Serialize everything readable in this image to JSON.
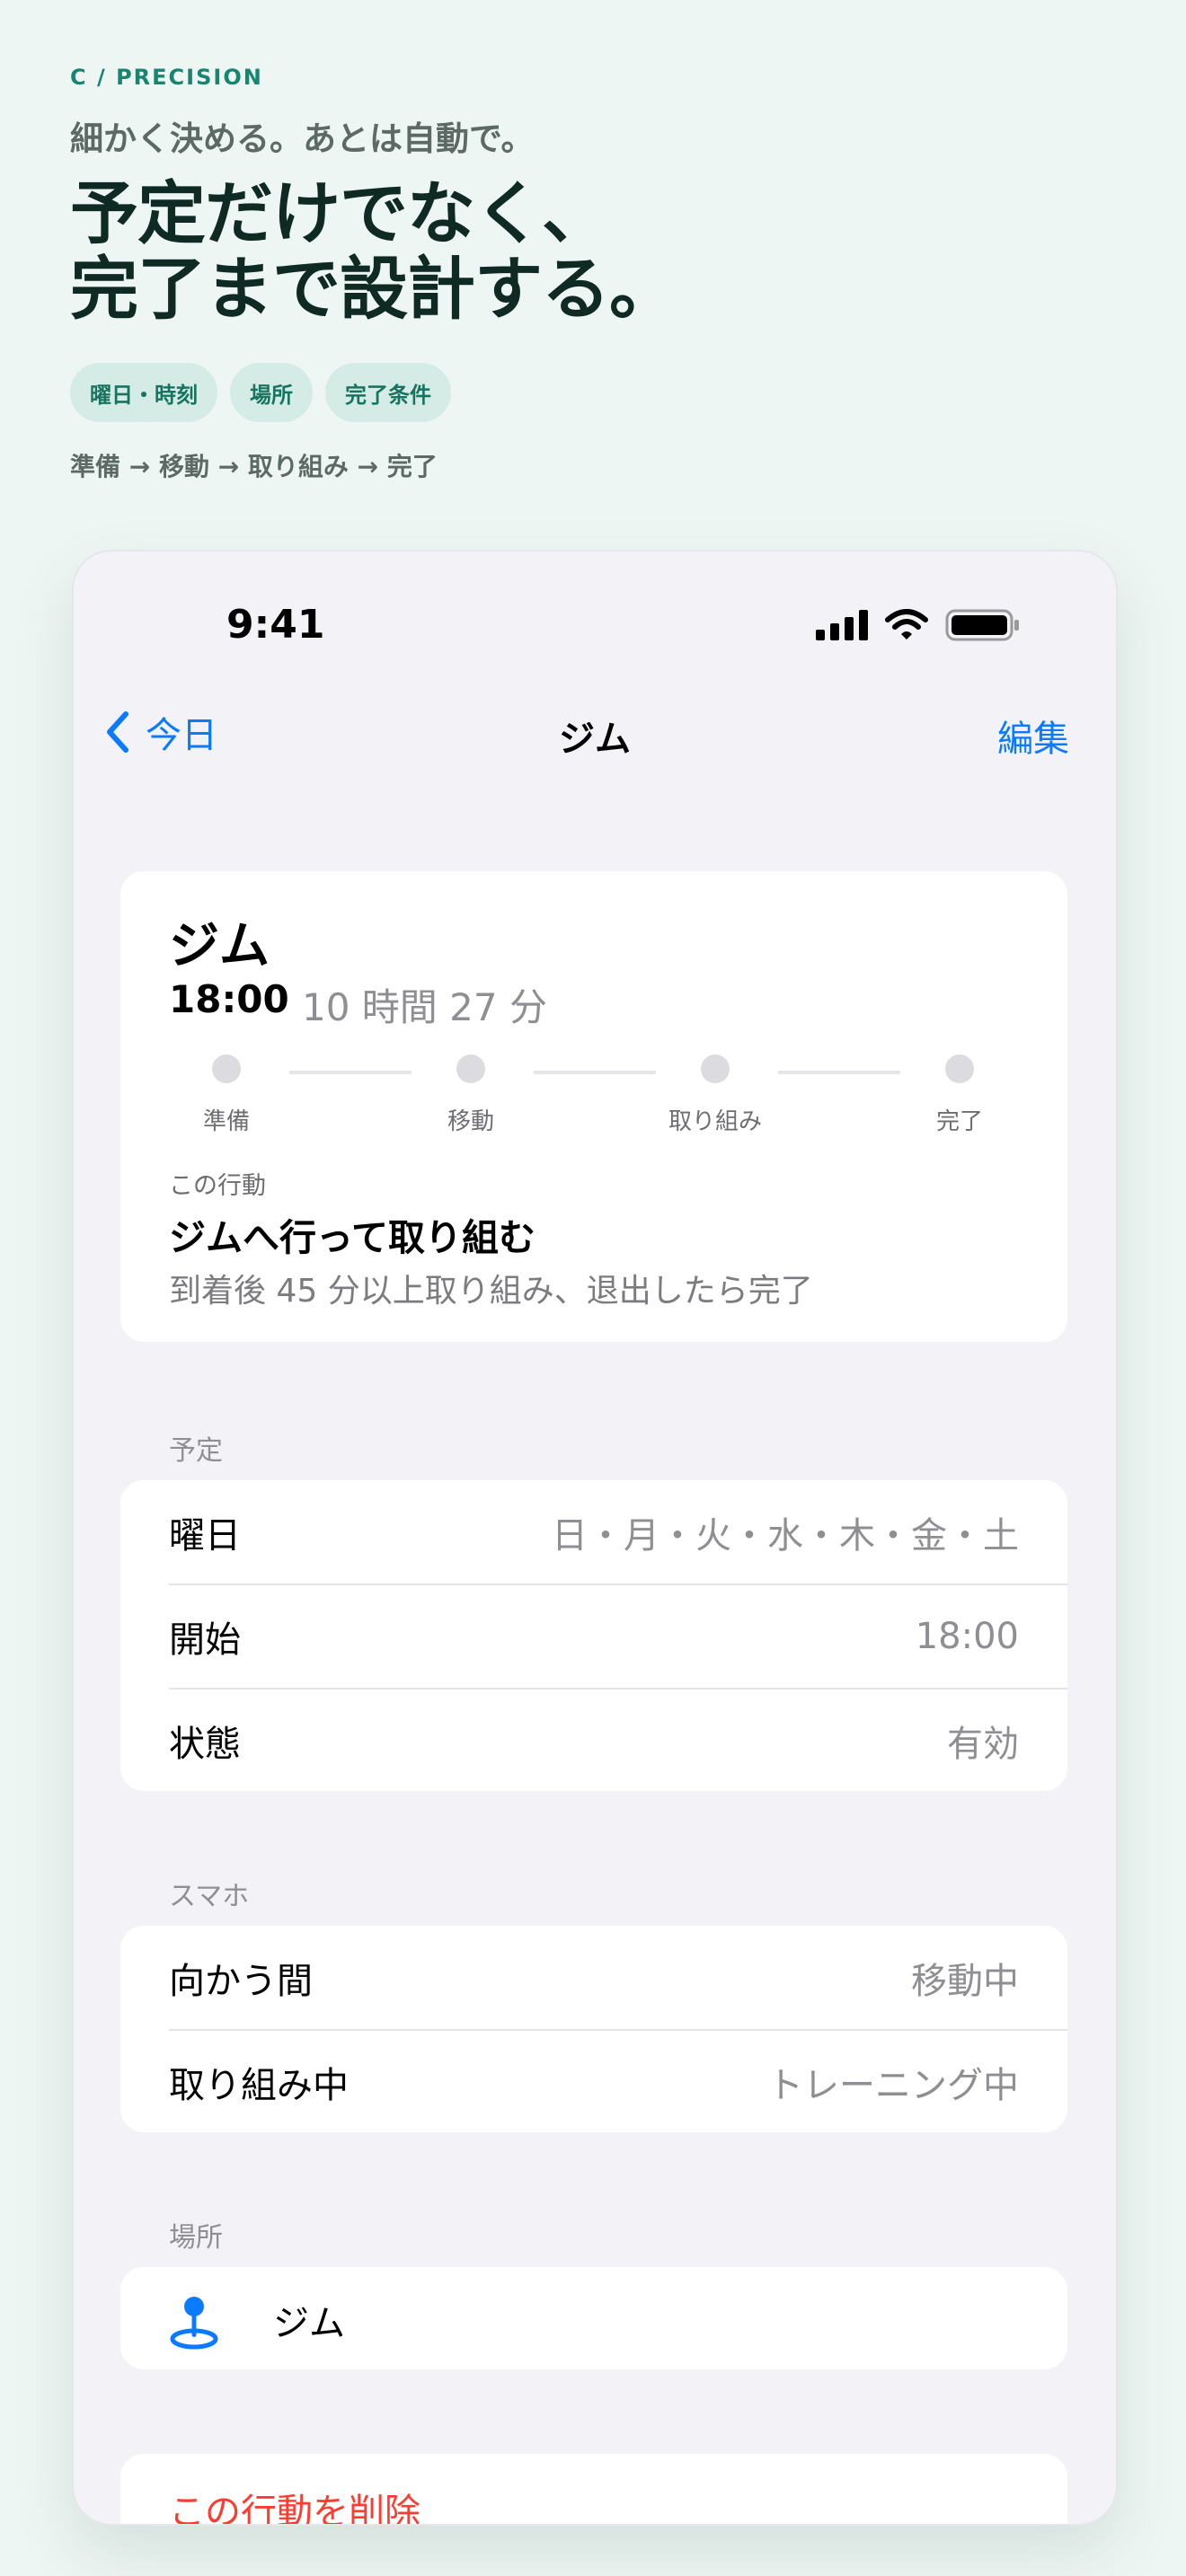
{
  "marketing": {
    "eyebrow": "C / PRECISION",
    "tagline": "細かく決める。あとは自動で。",
    "headline_line1": "予定だけでなく、",
    "headline_line2": "完了まで設計する。",
    "chips": [
      "曜日・時刻",
      "場所",
      "完了条件"
    ],
    "flow": "準備 → 移動 → 取り組み → 完了"
  },
  "status_bar": {
    "time": "9:41",
    "icons": [
      "cellular-signal-icon",
      "wifi-icon",
      "battery-icon"
    ]
  },
  "nav": {
    "back_label": "今日",
    "title": "ジム",
    "edit_label": "編集"
  },
  "summary": {
    "title": "ジム",
    "time": "18:00",
    "remaining": "10 時間 27 分",
    "steps": [
      "準備",
      "移動",
      "取り組み",
      "完了"
    ],
    "behavior_caption": "この行動",
    "behavior_title": "ジムへ行って取り組む",
    "behavior_desc": "到着後 45 分以上取り組み、退出したら完了"
  },
  "schedule": {
    "header": "予定",
    "rows": [
      {
        "label": "曜日",
        "value": "日・月・火・水・木・金・土"
      },
      {
        "label": "開始",
        "value": "18:00"
      },
      {
        "label": "状態",
        "value": "有効"
      }
    ]
  },
  "phone_mode": {
    "header": "スマホ",
    "rows": [
      {
        "label": "向かう間",
        "value": "移動中"
      },
      {
        "label": "取り組み中",
        "value": "トレーニング中"
      }
    ]
  },
  "location": {
    "header": "場所",
    "name": "ジム",
    "icon": "location-pin-icon"
  },
  "delete": {
    "label": "この行動を削除"
  },
  "colors": {
    "accent_blue": "#0a7aff",
    "destructive_red": "#ff3b30",
    "brand_green": "#17856f",
    "page_background": "#eef6f3"
  }
}
